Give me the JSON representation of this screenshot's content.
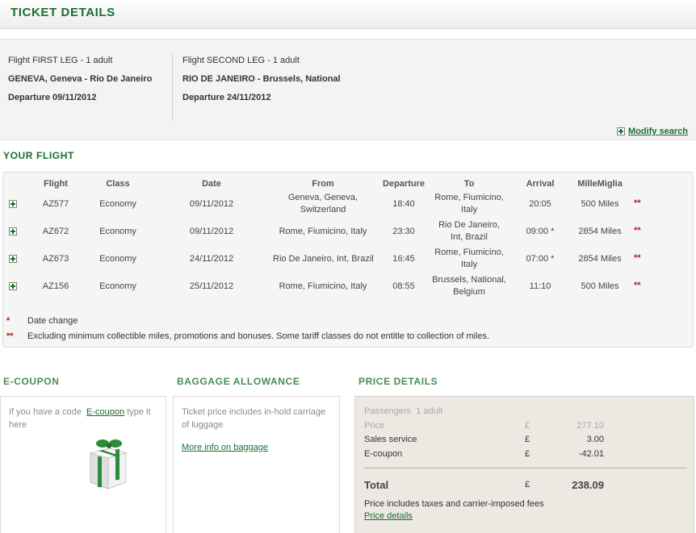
{
  "header": {
    "title": "TICKET DETAILS"
  },
  "legs": [
    {
      "title": "Flight FIRST LEG - 1 adult",
      "route": "GENEVA, Geneva - Rio De Janeiro",
      "departure_label": "Departure",
      "departure_date": "09/11/2012"
    },
    {
      "title": "Flight SECOND LEG - 1 adult",
      "route": "RIO DE JANEIRO - Brussels, National",
      "departure_label": "Departure",
      "departure_date": "24/11/2012"
    }
  ],
  "modify_search": "Modify search",
  "your_flight": {
    "title": "YOUR FLIGHT",
    "columns": [
      "Flight",
      "Class",
      "Date",
      "From",
      "Departure",
      "To",
      "Arrival",
      "MilleMiglia"
    ],
    "rows": [
      {
        "flight": "AZ577",
        "class": "Economy",
        "date": "09/11/2012",
        "from": "Geneva, Geneva,\nSwitzerland",
        "departure": "18:40",
        "to": "Rome, Fiumicino,\nItaly",
        "arrival": "20:05",
        "miles": "500 Miles",
        "mark": "**"
      },
      {
        "flight": "AZ672",
        "class": "Economy",
        "date": "09/11/2012",
        "from": "Rome, Fiumicino, Italy",
        "departure": "23:30",
        "to": "Rio De Janeiro,\nInt, Brazil",
        "arrival": "09:00 *",
        "miles": "2854 Miles",
        "mark": "**"
      },
      {
        "flight": "AZ673",
        "class": "Economy",
        "date": "24/11/2012",
        "from": "Rio De Janeiro, Int, Brazil",
        "departure": "16:45",
        "to": "Rome, Fiumicino,\nItaly",
        "arrival": "07:00 *",
        "miles": "2854 Miles",
        "mark": "**"
      },
      {
        "flight": "AZ156",
        "class": "Economy",
        "date": "25/11/2012",
        "from": "Rome, Fiumicino, Italy",
        "departure": "08:55",
        "to": "Brussels, National,\nBelgium",
        "arrival": "11:10",
        "miles": "500 Miles",
        "mark": "**"
      }
    ],
    "notes": [
      {
        "mark": "*",
        "text": "Date change"
      },
      {
        "mark": "**",
        "text": "Excluding minimum collectible miles, promotions and bonuses. Some tariff classes do not entitle to collection of miles."
      }
    ]
  },
  "ecoupon": {
    "title": "E-COUPON",
    "text_before": "If you have a code",
    "link": "E-coupon",
    "text_after": "type it here"
  },
  "baggage": {
    "title": "BAGGAGE ALLOWANCE",
    "text": "Ticket price includes in-hold carriage of luggage",
    "link": "More info on baggage"
  },
  "price": {
    "title": "PRICE DETAILS",
    "passengers_label": "Passengers",
    "passengers_value": "1 adult",
    "lines": [
      {
        "label": "Price",
        "currency": "£",
        "amount": "277.10"
      },
      {
        "label": "Sales service",
        "currency": "£",
        "amount": "3.00"
      },
      {
        "label": "E-coupon",
        "currency": "£",
        "amount": "-42.01"
      }
    ],
    "total_label": "Total",
    "total_currency": "£",
    "total_amount": "238.09",
    "note": "Price includes taxes and carrier-imposed fees",
    "details_link": "Price details"
  },
  "icons": {
    "row_expand": "plus-box-icon",
    "modify": "plus-box-icon",
    "gift": "gift-box-icon"
  },
  "colors": {
    "accent": "#1a6e2e",
    "marker": "#b0201a",
    "price_bg": "#ede8e1"
  }
}
